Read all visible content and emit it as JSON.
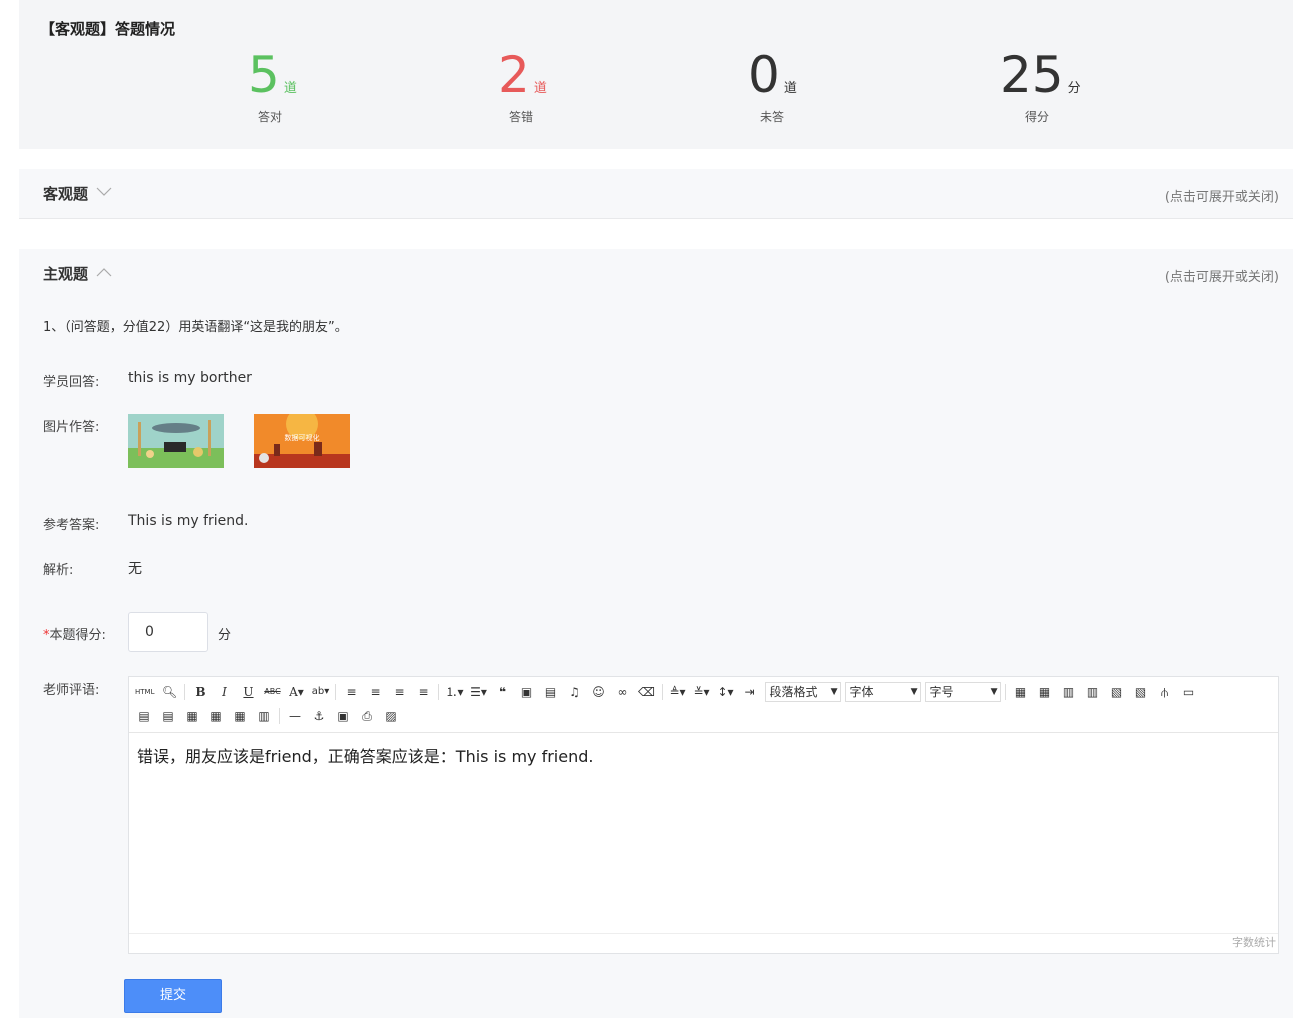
{
  "summary": {
    "title": "【客观题】答题情况",
    "stats": [
      {
        "value": "5",
        "unit": "道",
        "label": "答对",
        "color": "#5bc160"
      },
      {
        "value": "2",
        "unit": "道",
        "label": "答错",
        "color": "#e75a5a"
      },
      {
        "value": "0",
        "unit": "道",
        "label": "未答",
        "color": "#333333"
      },
      {
        "value": "25",
        "unit": "分",
        "label": "得分",
        "color": "#333333"
      }
    ]
  },
  "objective": {
    "name": "客观题",
    "hint": "(点击可展开或关闭)"
  },
  "subjective": {
    "name": "主观题",
    "hint": "(点击可展开或关闭)",
    "question": "1、（问答题，分值22）用英语翻译“这是我的朋友”。",
    "student_answer_label": "学员回答:",
    "student_answer": "this is my borther",
    "image_answer_label": "图片作答:",
    "image2_caption": "数据可视化",
    "reference_label": "参考答案:",
    "reference": "This is my friend.",
    "analysis_label": "解析:",
    "analysis": "无",
    "score_label": "本题得分:",
    "score_required": "*",
    "score_value": "0",
    "score_unit": "分",
    "comment_label": "老师评语:",
    "editor": {
      "select_paragraph": "段落格式",
      "select_font": "字体",
      "select_size": "字号",
      "content": "错误，朋友应该是friend，正确答案应该是：This is my friend.",
      "wordcount": "字数统计"
    },
    "submit": "提交"
  }
}
